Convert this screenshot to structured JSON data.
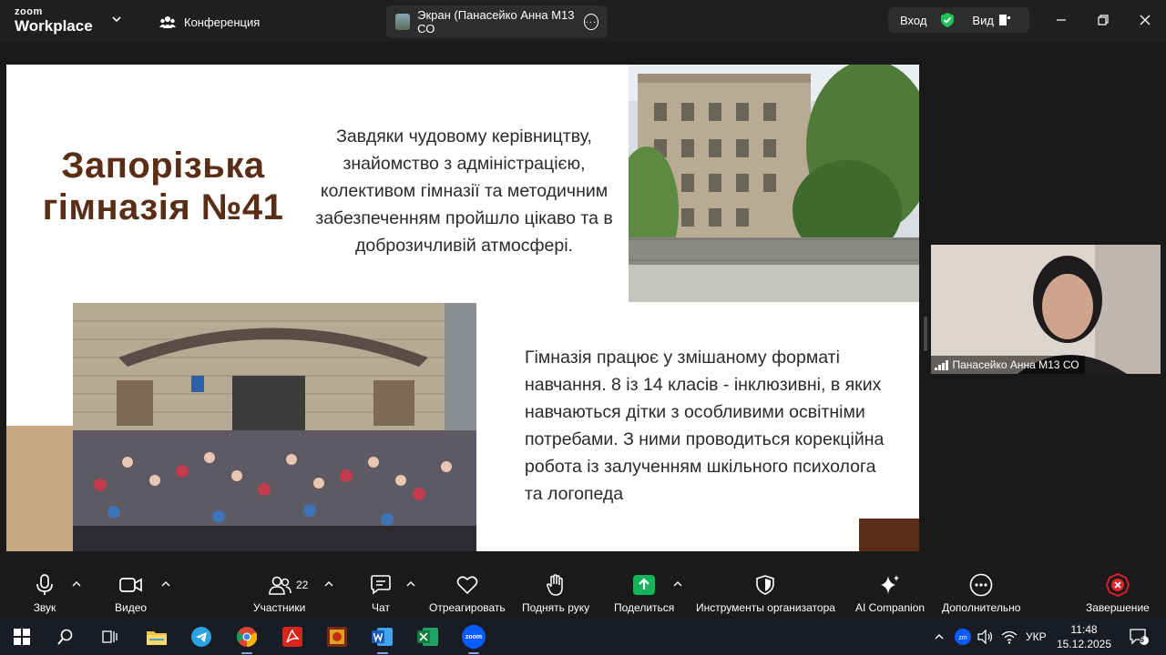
{
  "app": {
    "logo_line1": "zoom",
    "logo_line2": "Workplace",
    "tabs": [
      {
        "label": "Конференция"
      },
      {
        "label": "Экран (Панасейко Анна М13 СО"
      }
    ],
    "signin_label": "Вход",
    "view_label": "Вид"
  },
  "slide": {
    "title_line1": "Запорізька",
    "title_line2": "гімназія №41",
    "paragraph1": "Завдяки чудовому керівництву, знайомство з адміністрацією, колективом гімназії та методичним забезпеченням пройшло цікаво та в доброзичливій атмосфері.",
    "paragraph2": "Гімназія працює у змішаному форматі навчання. 8 із 14 класів - інклюзивні, в яких навчаються дітки з особливими освітніми потребами. З ними проводиться корекційна робота із залученням шкільного психолога та логопеда"
  },
  "participant": {
    "name": "Панасейко Анна М13 СО"
  },
  "toolbar": {
    "audio": "Звук",
    "video": "Видео",
    "participants": "Участники",
    "participants_count": "22",
    "chat": "Чат",
    "react": "Отреагировать",
    "raise_hand": "Поднять руку",
    "share": "Поделиться",
    "host_tools": "Инструменты организатора",
    "ai_companion": "AI Companion",
    "more": "Дополнительно",
    "end": "Завершение"
  },
  "taskbar": {
    "zoom_icon_text": "zoom",
    "language": "УКР",
    "time": "11:48",
    "date": "15.12.2025",
    "notifications": "6"
  },
  "colors": {
    "slide_title": "#5a2d17",
    "accent_beige": "#c9a885",
    "accent_brown": "#5a2d17",
    "zoom_share_green": "#13b45a",
    "end_red": "#e0242e",
    "shield_green": "#1fc25a"
  }
}
